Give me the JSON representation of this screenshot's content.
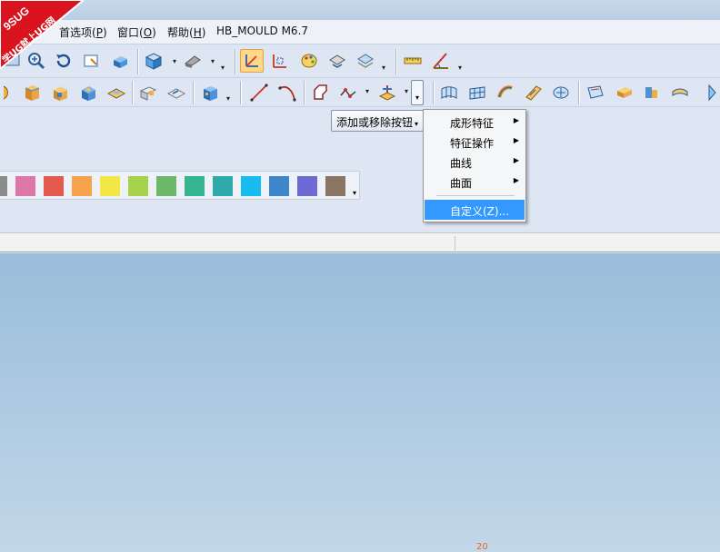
{
  "menubar": {
    "items": [
      {
        "label": "首选项(",
        "key": "P",
        "end": ")"
      },
      {
        "label": "窗口(",
        "key": "O",
        "end": ")"
      },
      {
        "label": "帮助(",
        "key": "H",
        "end": ")"
      }
    ],
    "plugin": "HB_MOULD M6.7"
  },
  "watermark": {
    "top": "9SUG",
    "bottom": "学UG就上UG网"
  },
  "context": {
    "button_label": "添加或移除按钮",
    "submenu": [
      {
        "label": "成形特征"
      },
      {
        "label": "特征操作"
      },
      {
        "label": "曲线"
      },
      {
        "label": "曲面"
      }
    ],
    "customize": "自定义(Z)..."
  },
  "palette": {
    "colors": [
      "#8c8c8c",
      "#dd77a8",
      "#e35b4f",
      "#f7a34d",
      "#f2e644",
      "#a6d14a",
      "#6db86a",
      "#36b592",
      "#2fa9aa",
      "#17bdf0",
      "#3e86cc",
      "#6e6ad3",
      "#8a7562"
    ]
  },
  "graphics": {
    "mark": "20"
  }
}
